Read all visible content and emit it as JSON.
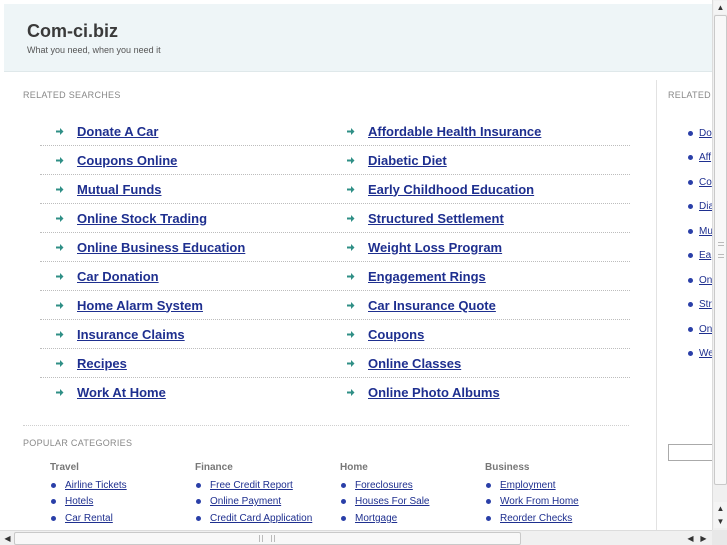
{
  "header": {
    "title": "Com-ci.biz",
    "tagline": "What you need, when you need it"
  },
  "related_searches": {
    "title": "RELATED SEARCHES",
    "rows": [
      [
        "Donate A Car",
        "Affordable Health Insurance"
      ],
      [
        "Coupons Online",
        "Diabetic Diet"
      ],
      [
        "Mutual Funds",
        "Early Childhood Education"
      ],
      [
        "Online Stock Trading",
        "Structured Settlement"
      ],
      [
        "Online Business Education",
        "Weight Loss Program"
      ],
      [
        "Car Donation",
        "Engagement Rings"
      ],
      [
        "Home Alarm System",
        "Car Insurance Quote"
      ],
      [
        "Insurance Claims",
        "Coupons"
      ],
      [
        "Recipes",
        "Online Classes"
      ],
      [
        "Work At Home",
        "Online Photo Albums"
      ]
    ]
  },
  "popular_categories": {
    "title": "POPULAR CATEGORIES",
    "columns": [
      {
        "heading": "Travel",
        "items": [
          "Airline Tickets",
          "Hotels",
          "Car Rental"
        ]
      },
      {
        "heading": "Finance",
        "items": [
          "Free Credit Report",
          "Online Payment",
          "Credit Card Application"
        ]
      },
      {
        "heading": "Home",
        "items": [
          "Foreclosures",
          "Houses For Sale",
          "Mortgage"
        ]
      },
      {
        "heading": "Business",
        "items": [
          "Employment",
          "Work From Home",
          "Reorder Checks"
        ]
      }
    ]
  },
  "sidebar": {
    "title": "RELATED",
    "items": [
      "Do",
      "Aff",
      "Co",
      "Dia",
      "Mu",
      "Ea",
      "On",
      "Str",
      "On",
      "We"
    ]
  },
  "colors": {
    "link": "#1e2f8f",
    "arrow": "#2f8f86",
    "header_bg": "#eef5f7"
  },
  "icons": {
    "arrow": "arrow-right-icon",
    "bullet": "bullet-dot-icon"
  }
}
